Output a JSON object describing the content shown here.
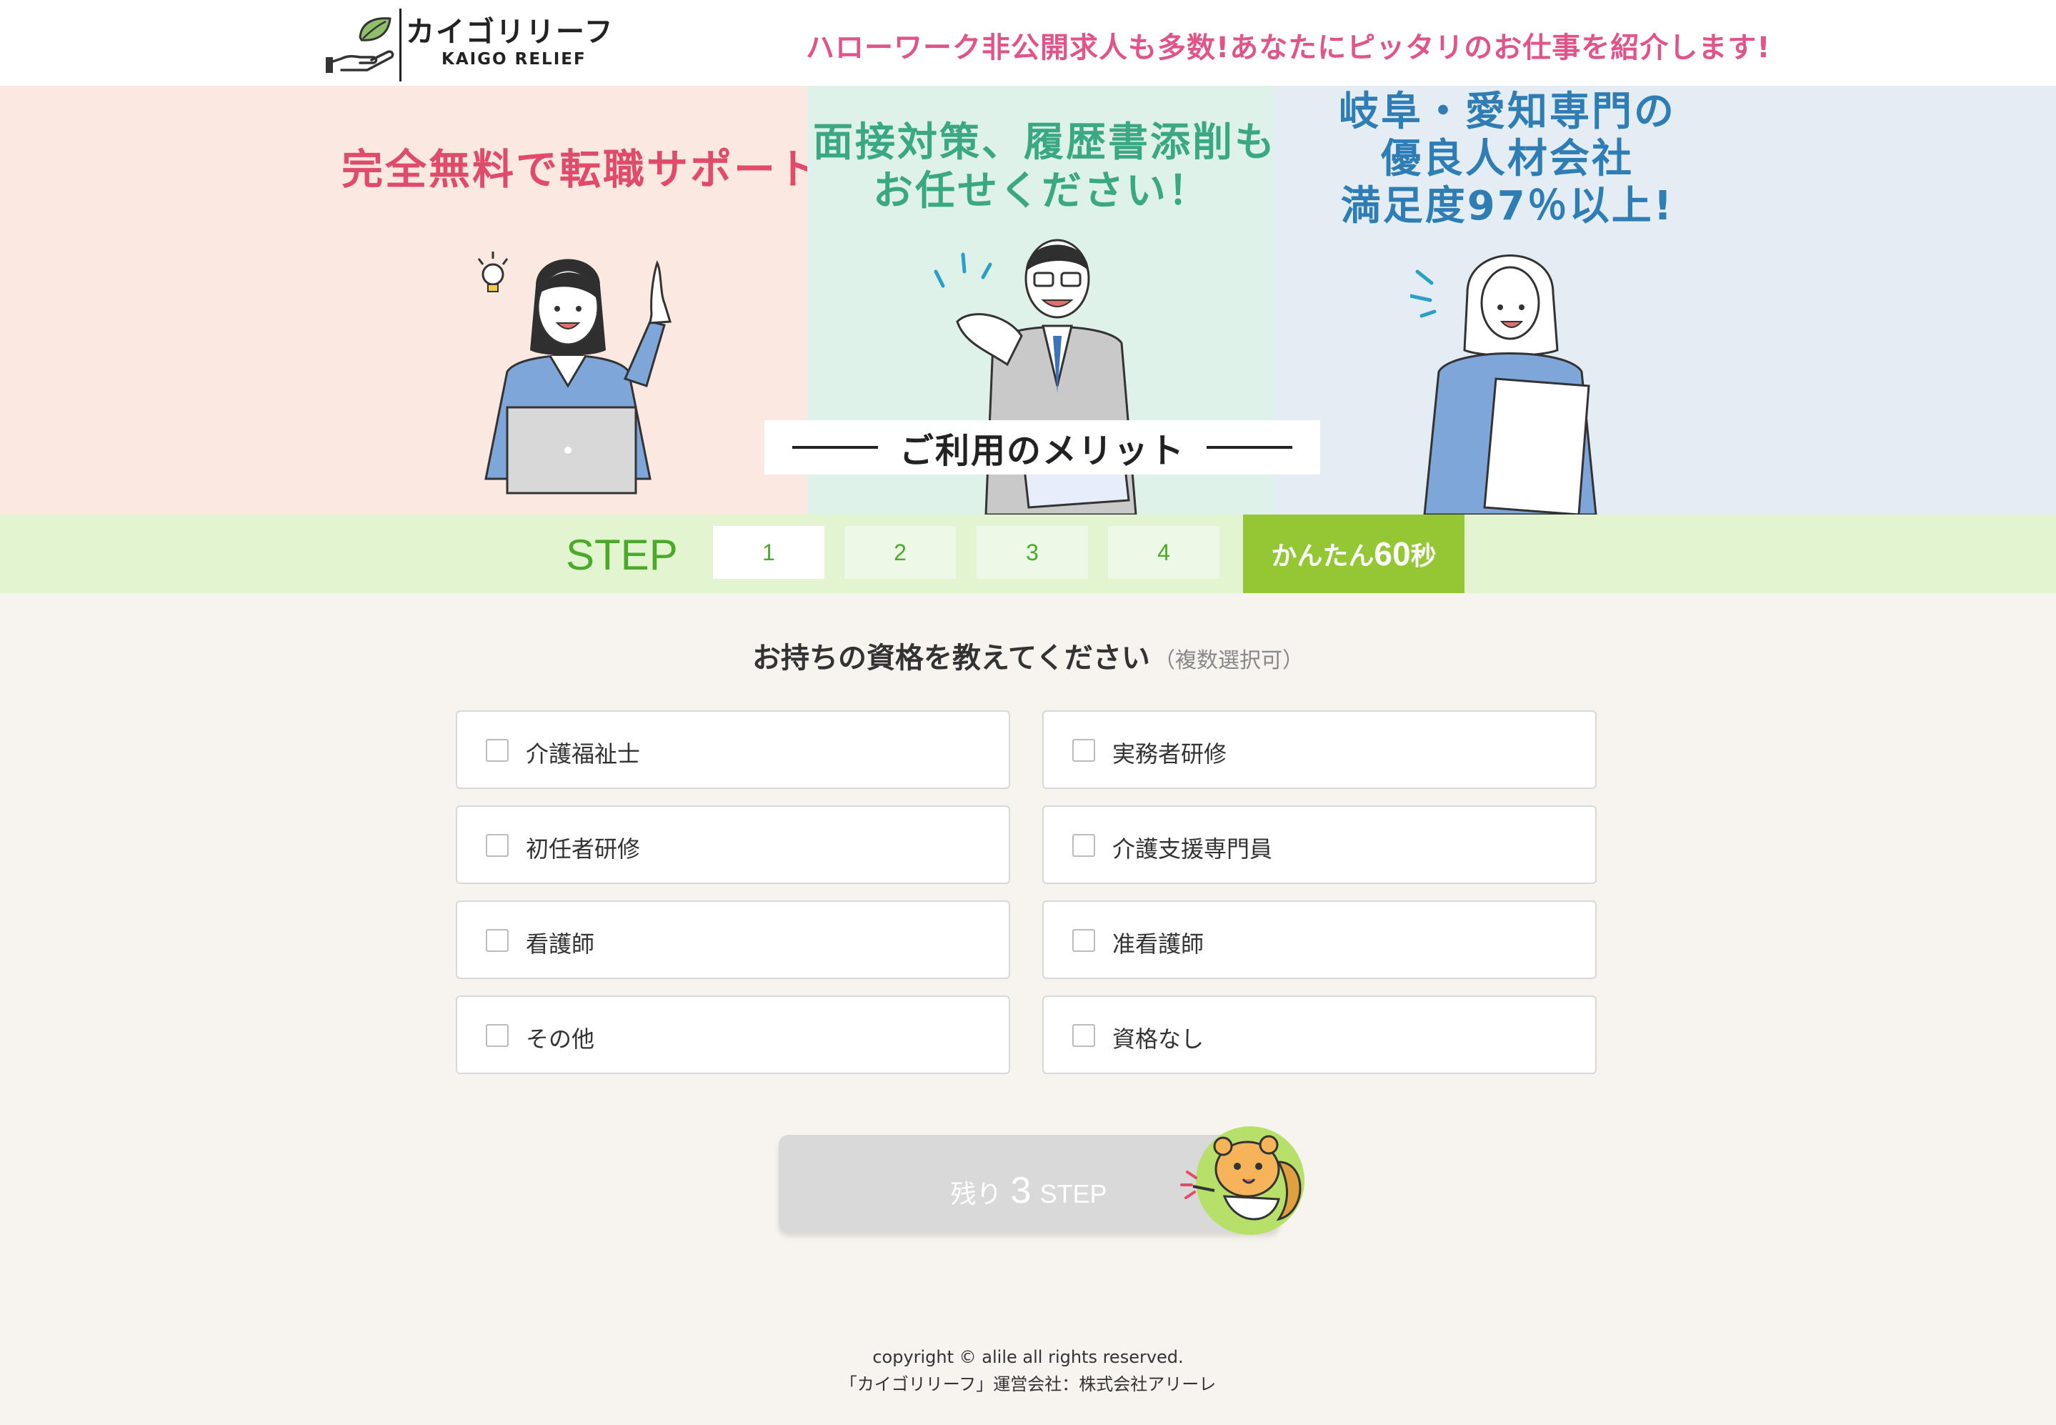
{
  "header": {
    "logo_ja": "カイゴリリーフ",
    "logo_en": "KAIGO RELIEF",
    "tagline": "ハローワーク非公開求人も多数!あなたにピッタリのお仕事を紹介します!"
  },
  "hero": {
    "panel1": "完全無料で転職サポート",
    "panel2": [
      "面接対策、履歴書添削も",
      "お任せください！"
    ],
    "panel3": [
      "岐阜・愛知専門の",
      "優良人材会社",
      "満足度97％以上!"
    ],
    "merit_title": "ご利用のメリット"
  },
  "steps": {
    "label": "STEP",
    "items": [
      "1",
      "2",
      "3",
      "4"
    ],
    "current": 1,
    "badge_pre": "かんたん",
    "badge_num": "60",
    "badge_post": "秒"
  },
  "question": {
    "title": "お持ちの資格を教えてください",
    "note": "（複数選択可）",
    "options": [
      "介護福祉士",
      "実務者研修",
      "初任者研修",
      "介護支援専門員",
      "看護師",
      "准看護師",
      "その他",
      "資格なし"
    ]
  },
  "next": {
    "pre": "残り",
    "num": "3",
    "post": "STEP"
  },
  "footer": {
    "copyright": "copyright © alile all rights reserved.",
    "company": "「カイゴリリーフ」運営会社：株式会社アリーレ"
  },
  "colors": {
    "pink": "#e0548a",
    "red": "#e04b6a",
    "teal": "#3aa882",
    "blue": "#2f7db5",
    "green": "#4caa2a",
    "badge": "#93c834"
  }
}
